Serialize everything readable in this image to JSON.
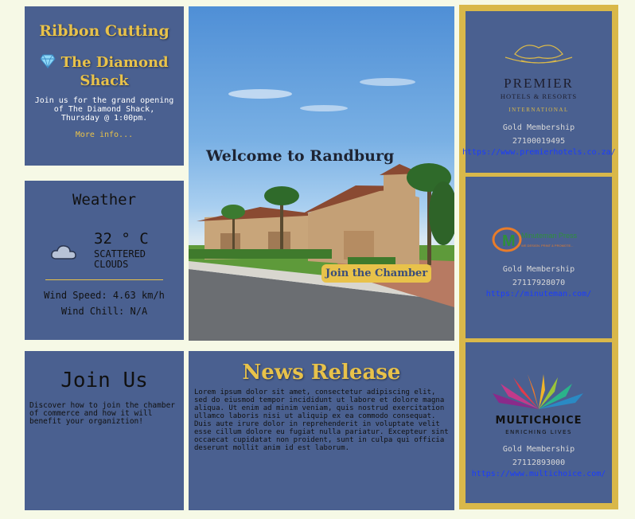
{
  "ribbon": {
    "title": "Ribbon Cutting",
    "event_icon": "gem-icon",
    "event_name": "The Diamond Shack",
    "description": "Join us for the grand opening of The Diamond Shack, Thursday @ 1:00pm.",
    "more_link": "More info..."
  },
  "weather": {
    "title": "Weather",
    "icon": "cloud-icon",
    "temperature": "32 ° C",
    "condition": "SCATTERED CLOUDS",
    "wind_speed": "Wind Speed: 4.63 km/h",
    "wind_chill": "Wind Chill: N/A"
  },
  "hero": {
    "welcome": "Welcome to Randburg",
    "join_button": "Join the Chamber"
  },
  "join_us": {
    "title": "Join Us",
    "description": "Discover how to join the chamber of commerce and how it will benefit your organiztion!"
  },
  "news": {
    "title": "News Release",
    "body": "Lorem ipsum dolor sit amet, consectetur adipiscing elit, sed do eiusmod tempor incididunt ut labore et dolore magna aliqua. Ut enim ad minim veniam, quis nostrud exercitation ullamco laboris nisi ut aliquip ex ea commodo consequat. Duis aute irure dolor in reprehenderit in voluptate velit esse cillum dolore eu fugiat nulla pariatur. Excepteur sint occaecat cupidatat non proident, sunt in culpa qui officia deserunt mollit anim id est laborum."
  },
  "members": [
    {
      "logo_text": "PREMIER",
      "logo_sub": "HOTELS & RESORTS",
      "logo_sub2": "INTERNATIONAL",
      "level": "Gold Membership",
      "phone": "27100019495",
      "url": "https://www.premierhotels.co.za/"
    },
    {
      "logo_text": "Minuteman Press",
      "logo_sub": "WE DESIGN. PRINT & PROMOTE...",
      "level": "Gold Membership",
      "phone": "27117928070",
      "url": "https://minuteman.com/"
    },
    {
      "logo_text": "MULTICHOICE",
      "logo_sub": "ENRICHING LIVES",
      "level": "Gold Membership",
      "phone": "27112893000",
      "url": "https://www.multichoice.com/"
    }
  ],
  "colors": {
    "page_bg": "#f6f9e6",
    "panel": "#4a6090",
    "gold": "#e8c24a",
    "link": "#1a3cff"
  }
}
